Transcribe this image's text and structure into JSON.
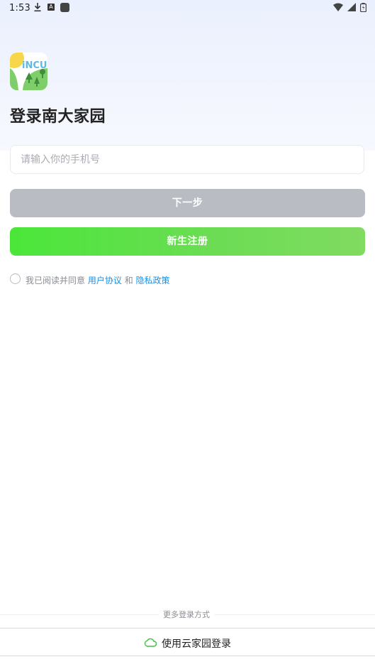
{
  "status_bar": {
    "time": "1:53",
    "notification_a": "A",
    "icons": [
      "download-icon",
      "a-notification-icon",
      "app-square-icon",
      "wifi-icon",
      "signal-icon",
      "battery-icon"
    ]
  },
  "header": {
    "logo_text": "iNCU",
    "title": "登录南大家园"
  },
  "form": {
    "phone_placeholder": "请输入你的手机号",
    "phone_value": "",
    "next_label": "下一步",
    "register_label": "新生注册"
  },
  "agreement": {
    "prefix": "我已阅读并同意",
    "user_agreement": "用户协议",
    "and": "和",
    "privacy_policy": "隐私政策",
    "checked": false
  },
  "footer": {
    "more_label": "更多登录方式",
    "cloud_login_label": "使用云家园登录"
  },
  "colors": {
    "accent_green": "#4be63a",
    "disabled_gray": "#b9bcc3",
    "link_blue": "#1a8fe6",
    "cloud_icon": "#3cbf3c"
  }
}
